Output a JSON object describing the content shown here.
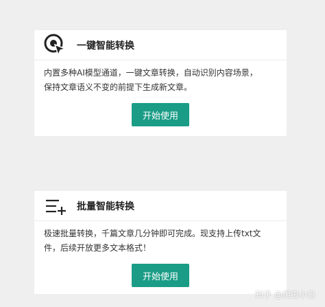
{
  "cards": [
    {
      "icon": "cursor-target-icon",
      "title": "一键智能转换",
      "desc_lines": [
        "内置多种AI模型通道，一键文章转换，自动识别内容场景，",
        "保持文章语义不变的前提下生成新文章。"
      ],
      "button_label": "开始使用"
    },
    {
      "icon": "list-add-icon",
      "title": "批量智能转换",
      "desc_lines": [
        "极速批量转换，千篇文章几分钟即可完成。现支持上传txt文",
        "件，后续开放更多文本格式！"
      ],
      "button_label": "开始使用"
    }
  ],
  "watermark": "知乎 @爬虫小白",
  "colors": {
    "accent": "#1a9c86",
    "background": "#efefef",
    "card": "#ffffff"
  }
}
